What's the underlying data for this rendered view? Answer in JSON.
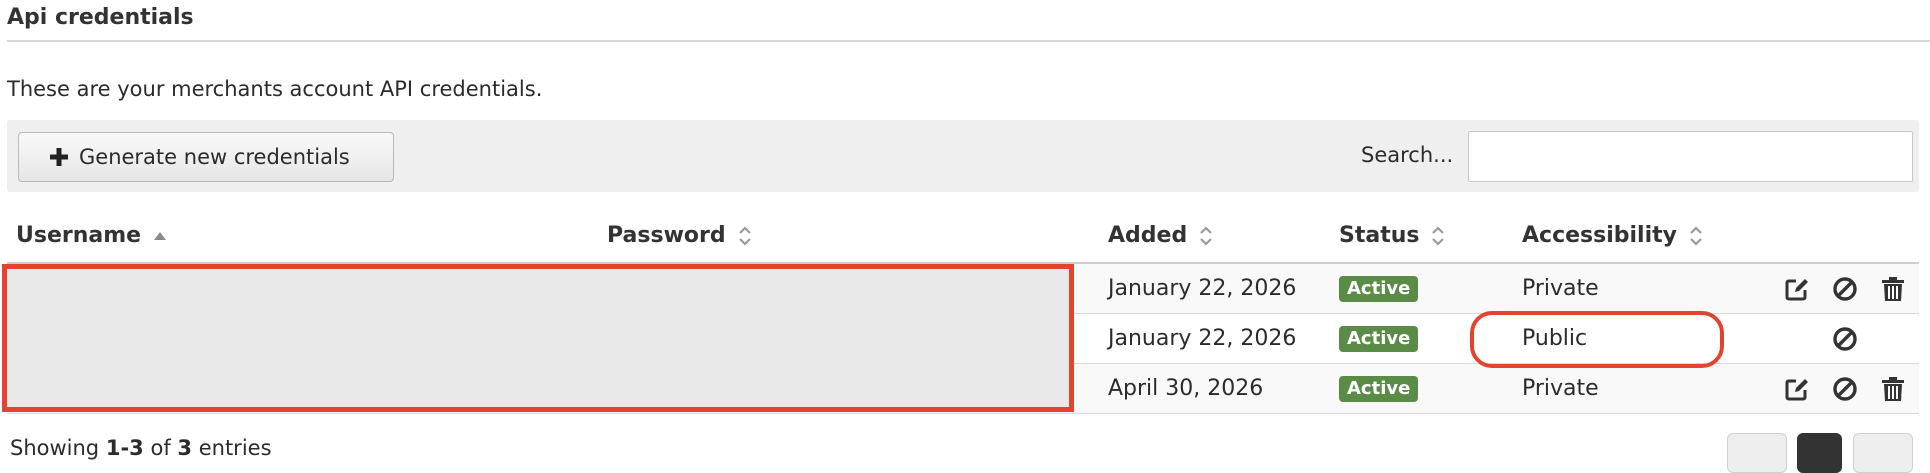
{
  "section": {
    "title": "Api credentials",
    "intro": "These are your merchants account API credentials."
  },
  "toolbar": {
    "generate_label": "Generate new credentials",
    "search_label": "Search...",
    "search_value": ""
  },
  "table": {
    "columns": [
      "Username",
      "Password",
      "Added",
      "Status",
      "Accessibility"
    ],
    "sort": {
      "column": "Username",
      "direction": "asc"
    },
    "rows": [
      {
        "added": "January 22, 2026",
        "status": "Active",
        "accessibility": "Private",
        "actions": [
          "edit",
          "disable",
          "delete"
        ]
      },
      {
        "added": "January 22, 2026",
        "status": "Active",
        "accessibility": "Public",
        "actions": [
          "disable"
        ]
      },
      {
        "added": "April 30, 2026",
        "status": "Active",
        "accessibility": "Private",
        "actions": [
          "edit",
          "disable",
          "delete"
        ]
      }
    ]
  },
  "footer": {
    "showing_prefix": "Showing",
    "range": "1-3",
    "of_word": "of",
    "total": "3",
    "suffix": "entries"
  },
  "colors": {
    "status_active": "#5a8c48",
    "annotation": "#e24430"
  },
  "icons": [
    "plus-icon",
    "sort-asc-icon",
    "sort-both-icon",
    "edit-icon",
    "disable-icon",
    "trash-icon"
  ]
}
